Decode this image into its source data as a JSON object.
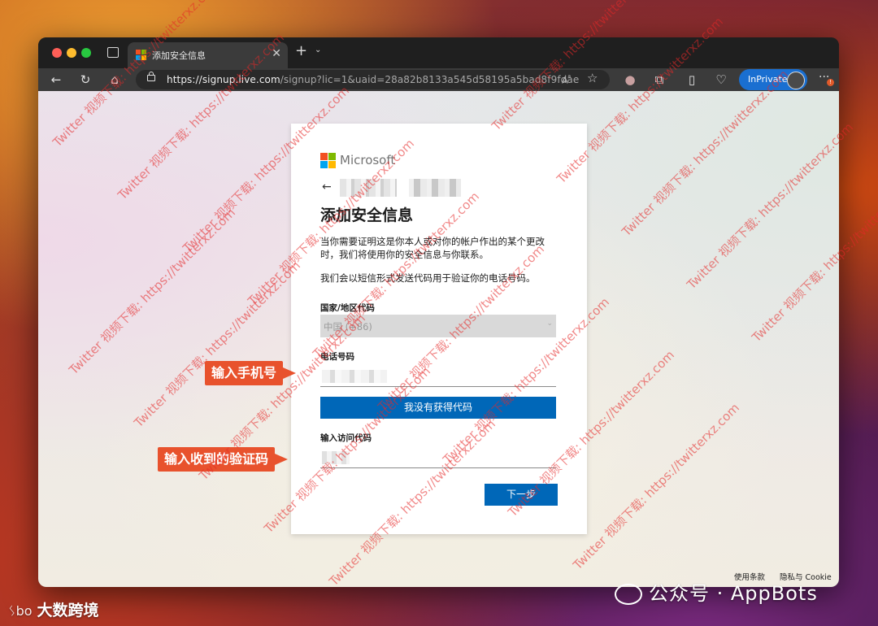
{
  "browser": {
    "tab_title": "添加安全信息",
    "url_host": "https://signup.live.com",
    "url_rest": "/signup?lic=1&uaid=28a82b8133a545d58195a5bad8f9fdae",
    "inprivate_label": "InPrivate",
    "more_badge": "!"
  },
  "page": {
    "brand": "Microsoft",
    "heading": "添加安全信息",
    "para1": "当你需要证明这是你本人或对你的帐户作出的某个更改时，我们将使用你的安全信息与你联系。",
    "para2": "我们会以短信形式发送代码用于验证你的电话号码。",
    "country_label": "国家/地区代码",
    "country_value": "中国 (+86)",
    "phone_label": "电话号码",
    "no_code_button": "我没有获得代码",
    "code_label": "输入访问代码",
    "next_button": "下一步",
    "footer_terms": "使用条款",
    "footer_privacy": "隐私与 Cookie"
  },
  "annotations": {
    "callout_phone": "输入手机号",
    "callout_code": "输入收到的验证码"
  },
  "watermarks": {
    "wechat": "公众号 · AppBots",
    "dashu": "大数跨境",
    "dashu_logo": "ᛊbo",
    "diagonal": "Twitter 视频下载: https://twitterxz.com"
  },
  "colors": {
    "accent": "#0067b8",
    "inprivate": "#1a6fd1",
    "callout": "#e8522d",
    "ms_red": "#f25022",
    "ms_green": "#7fba00",
    "ms_blue": "#00a4ef",
    "ms_yellow": "#ffb900"
  }
}
